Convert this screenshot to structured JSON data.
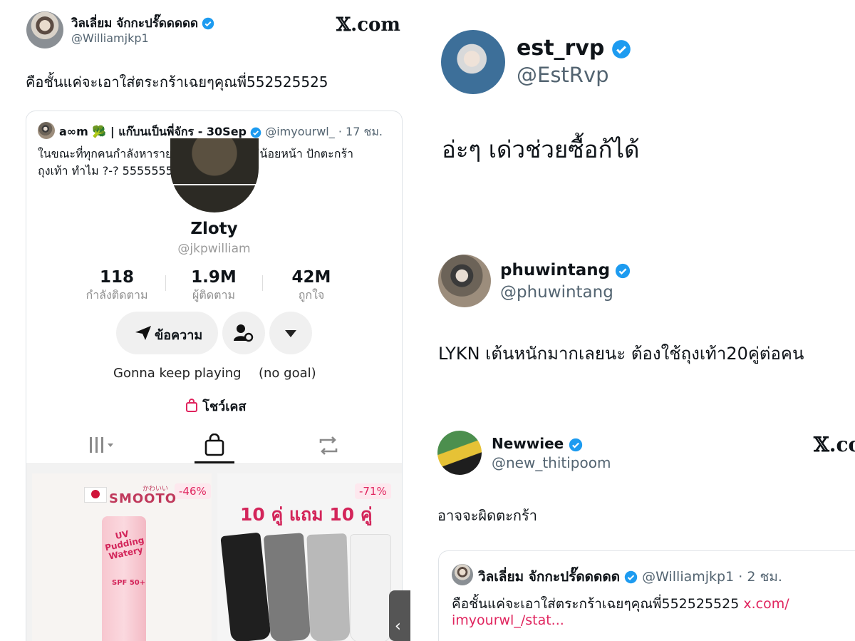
{
  "left": {
    "author": {
      "name": "วิลเลี่ยม จักกะปรั๊ดดดดด",
      "handle": "@Williamjkp1",
      "avatar": "avatar-william"
    },
    "brand": "𝕏.com",
    "tweet_text": "คือชั้นแค่จะเอาใส่ตระกร้าเฉยๆคุณพี่552525525",
    "quoted": {
      "name": "a∞m 🥦 | แก๊บนเป็นพี่จักร - 30Sep",
      "handle": "@imyourwl_",
      "time": "· 17 ชม.",
      "text_line1": "ในขณะที่ทุกคนกำลังหารายได้เสริม ดาราก็ไม่น้อยหน้า ปักตะกร้า",
      "text_line2": "ถุงเท้า ทำไม ?-? 555555555555555"
    },
    "profile": {
      "display_name": "Zloty",
      "username": "@jkpwilliam",
      "stats": [
        {
          "value": "118",
          "label": "กำลังติดตาม"
        },
        {
          "value": "1.9M",
          "label": "ผู้ติดตาม"
        },
        {
          "value": "42M",
          "label": "ถูกใจ"
        }
      ],
      "message_button": "ข้อความ",
      "bio_left": "Gonna keep playing",
      "bio_right": "(no goal)",
      "showcase": "โชว์เคส",
      "tabs": [
        "videos-grid-icon",
        "shopping-bag-icon",
        "repost-icon"
      ]
    },
    "products": [
      {
        "discount": "-46%",
        "brand": "SMOOTO",
        "brand_small": "かわいい",
        "tube_text": "UV Pudding Watery",
        "spf": "SPF 50+"
      },
      {
        "discount": "-71%",
        "headline": "10 คู่ แถม 10 คู่"
      }
    ],
    "socks_colors": [
      "#1f1f1f",
      "#7a7a7a",
      "#b9b9b9",
      "#f2f2f2"
    ]
  },
  "right": {
    "est": {
      "name": "est_rvp",
      "handle": "@EstRvp",
      "text": "อ่ะๆ เด่วช่วยซื้อก้ได้"
    },
    "phuwin": {
      "name": "phuwintang",
      "handle": "@phuwintang",
      "text": "LYKN เต้นหนักมากเลยนะ ต้องใช้ถุงเท้า20คู่ต่อคน"
    },
    "newwiee": {
      "name": "Newwiee",
      "handle": "@new_thitipoom",
      "text": "อาจจะผิดตะกร้า",
      "brand": "𝕏.co"
    },
    "quoted": {
      "name": "วิลเลี่ยม จักกะปรั๊ดดดดด",
      "handle": "@Williamjkp1",
      "time": "· 2 ชม.",
      "text": "คือชั้นแค่จะเอาใส่ตระกร้าเฉยๆคุณพี่552525525",
      "link_part1": "x.com/",
      "link_part2": "imyourwl_/stat..."
    }
  },
  "colors": {
    "verified": "#1d9bf0",
    "text": "#0f1419",
    "muted": "#536471",
    "pink": "#e0245e"
  }
}
